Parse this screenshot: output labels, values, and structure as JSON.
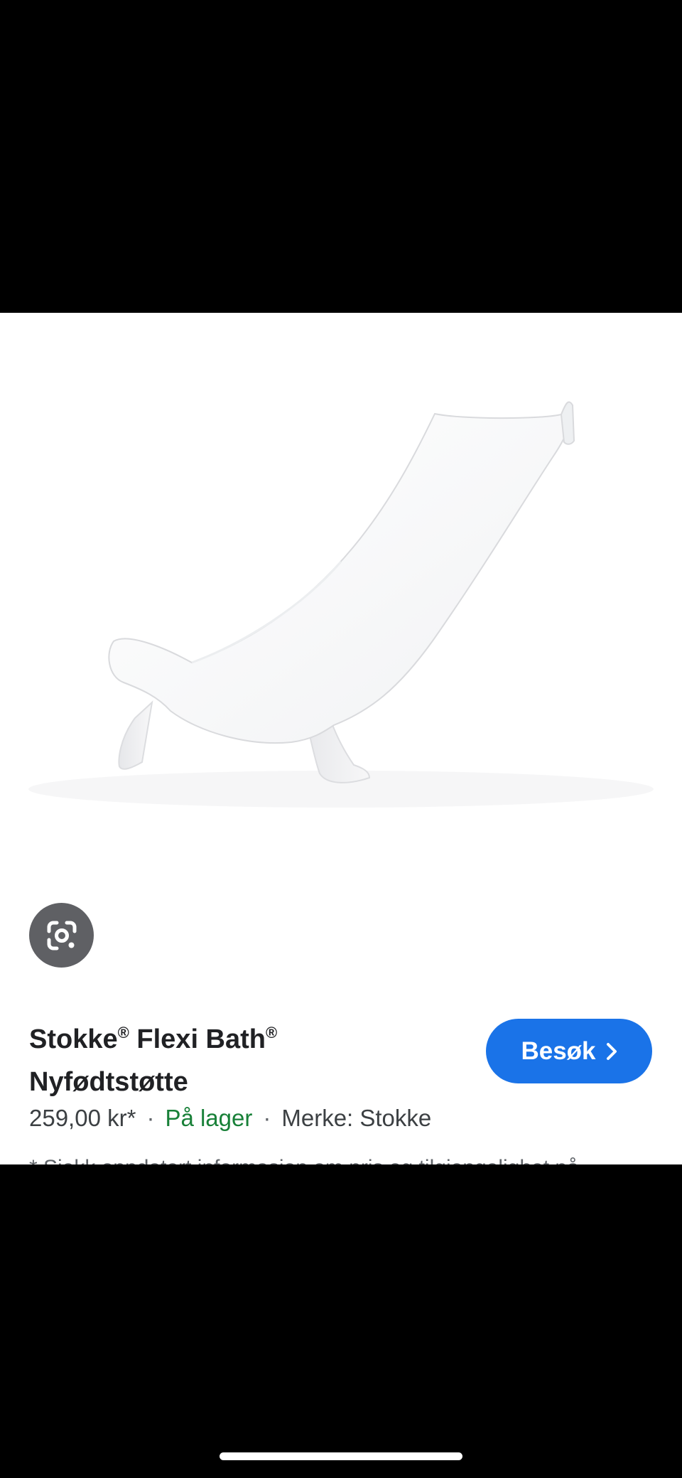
{
  "product": {
    "title_part1": "Stokke",
    "title_part2": "Flexi Bath",
    "title_part3": "Nyfødtstøtte",
    "registered_mark": "®",
    "price": "259,00 kr*",
    "separator": "·",
    "availability": "På lager",
    "brand": "Merke: Stokke",
    "disclaimer": "* Sjekk oppdatert informasjon om pris og tilgjengelighet på"
  },
  "actions": {
    "visit_label": "Besøk"
  },
  "icons": {
    "lens": "google-lens-icon",
    "visit_chevron": "chevron-right-icon"
  },
  "colors": {
    "visit_button": "#1a73e8",
    "in_stock": "#188038",
    "lens_button": "#5f6064"
  }
}
